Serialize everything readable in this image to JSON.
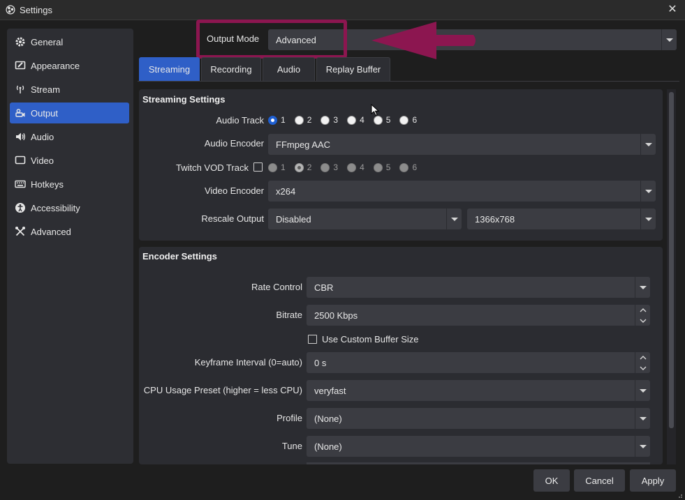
{
  "window": {
    "title": "Settings",
    "close_glyph": "✕"
  },
  "sidebar": {
    "items": [
      {
        "label": "General",
        "icon": "gear-icon"
      },
      {
        "label": "Appearance",
        "icon": "appearance-icon"
      },
      {
        "label": "Stream",
        "icon": "broadcast-icon"
      },
      {
        "label": "Output",
        "icon": "output-icon",
        "active": true
      },
      {
        "label": "Audio",
        "icon": "speaker-icon"
      },
      {
        "label": "Video",
        "icon": "monitor-icon"
      },
      {
        "label": "Hotkeys",
        "icon": "keyboard-icon"
      },
      {
        "label": "Accessibility",
        "icon": "accessibility-icon"
      },
      {
        "label": "Advanced",
        "icon": "tools-icon"
      }
    ]
  },
  "output_mode": {
    "label": "Output Mode",
    "value": "Advanced"
  },
  "tabs": [
    {
      "label": "Streaming",
      "active": true
    },
    {
      "label": "Recording"
    },
    {
      "label": "Audio"
    },
    {
      "label": "Replay Buffer"
    }
  ],
  "streaming": {
    "title": "Streaming Settings",
    "audio_track": {
      "label": "Audio Track",
      "options": [
        "1",
        "2",
        "3",
        "4",
        "5",
        "6"
      ],
      "selected": "1"
    },
    "audio_encoder": {
      "label": "Audio Encoder",
      "value": "FFmpeg AAC"
    },
    "twitch_vod": {
      "label": "Twitch VOD Track",
      "options": [
        "1",
        "2",
        "3",
        "4",
        "5",
        "6"
      ],
      "selected": "2"
    },
    "video_encoder": {
      "label": "Video Encoder",
      "value": "x264"
    },
    "rescale": {
      "label": "Rescale Output",
      "value": "Disabled",
      "resolution": "1366x768"
    }
  },
  "encoder": {
    "title": "Encoder Settings",
    "rate_control": {
      "label": "Rate Control",
      "value": "CBR"
    },
    "bitrate": {
      "label": "Bitrate",
      "value": "2500 Kbps"
    },
    "custom_buffer": {
      "label": "Use Custom Buffer Size"
    },
    "keyframe": {
      "label": "Keyframe Interval (0=auto)",
      "value": "0 s"
    },
    "cpu_preset": {
      "label": "CPU Usage Preset (higher = less CPU)",
      "value": "veryfast"
    },
    "profile": {
      "label": "Profile",
      "value": "(None)"
    },
    "tune": {
      "label": "Tune",
      "value": "(None)"
    }
  },
  "buttons": {
    "ok": "OK",
    "cancel": "Cancel",
    "apply": "Apply"
  },
  "colors": {
    "accent": "#2f5fc7",
    "annotation": "#8c1650",
    "background": "#1e1e1e"
  }
}
